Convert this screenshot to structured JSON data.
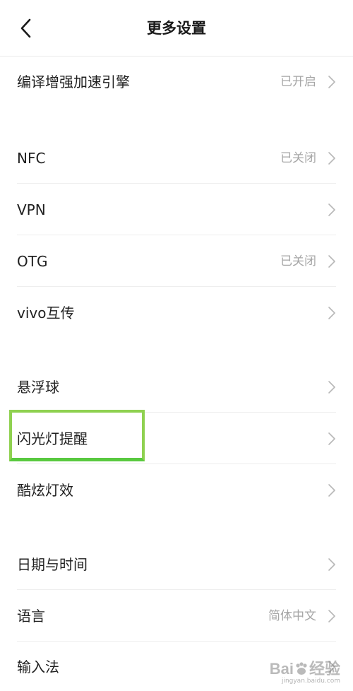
{
  "header": {
    "title": "更多设置",
    "back_icon": "chevron-left-icon"
  },
  "settings": [
    {
      "label": "编译增强加速引擎",
      "status": "已开启"
    },
    {
      "label": "NFC",
      "status": "已关闭"
    },
    {
      "label": "VPN",
      "status": ""
    },
    {
      "label": "OTG",
      "status": "已关闭"
    },
    {
      "label": "vivo互传",
      "status": ""
    },
    {
      "label": "悬浮球",
      "status": ""
    },
    {
      "label": "闪光灯提醒",
      "status": ""
    },
    {
      "label": "酷炫灯效",
      "status": ""
    },
    {
      "label": "日期与时间",
      "status": ""
    },
    {
      "label": "语言",
      "status": "简体中文"
    },
    {
      "label": "输入法",
      "status": ""
    }
  ],
  "watermark": {
    "brand": "Bai",
    "brand_suffix": "经验",
    "url": "jingyan.baidu.com"
  },
  "colors": {
    "highlight_border": "#8fd150",
    "status_text": "#a6a6a6",
    "divider": "#eeeeee"
  }
}
